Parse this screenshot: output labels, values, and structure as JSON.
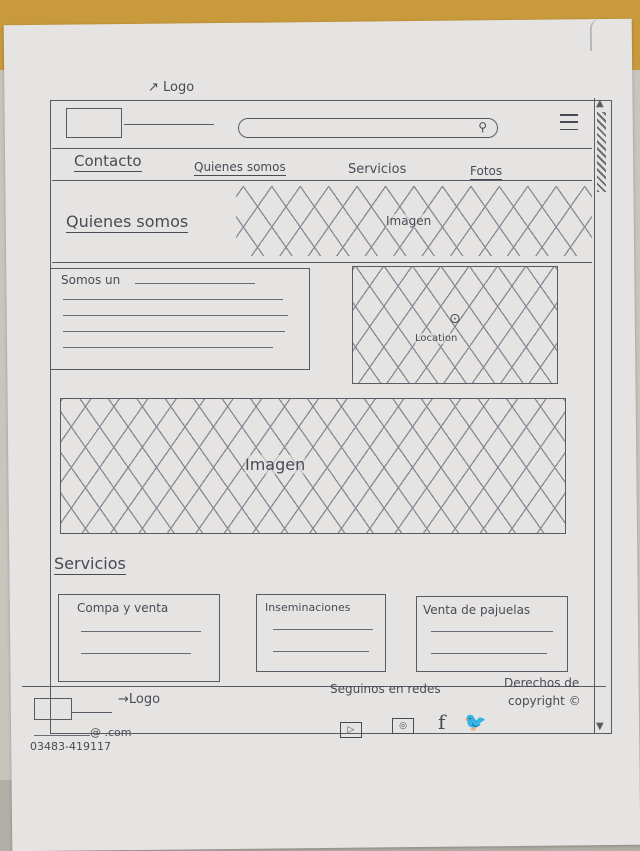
{
  "header": {
    "logo_annotation": "Logo",
    "search_icon": "search-icon",
    "menu_icon": "hamburger-menu-icon"
  },
  "nav": {
    "items": [
      {
        "label": "Contacto"
      },
      {
        "label": "Quienes somos"
      },
      {
        "label": "Servicios"
      },
      {
        "label": "Fotos"
      }
    ]
  },
  "hero": {
    "title": "Quienes somos",
    "image_label": "Imagen"
  },
  "about": {
    "intro_text": "Somos un"
  },
  "location": {
    "label": "Location",
    "icon": "map-pin-icon"
  },
  "banner": {
    "image_label": "Imagen"
  },
  "services": {
    "title": "Servicios",
    "cards": [
      {
        "title": "Compa y venta"
      },
      {
        "title": "Inseminaciones"
      },
      {
        "title": "Venta de pajuelas"
      }
    ]
  },
  "footer": {
    "logo_annotation": "Logo",
    "email": "@ .com",
    "phone": "03483-419117",
    "social_title": "Seguinos en redes",
    "rights_line1": "Derechos de",
    "rights_line2": "copyright",
    "copyright_icon": "copyright-icon",
    "social_icons": [
      "youtube-icon",
      "instagram-icon",
      "facebook-icon",
      "twitter-icon"
    ]
  }
}
